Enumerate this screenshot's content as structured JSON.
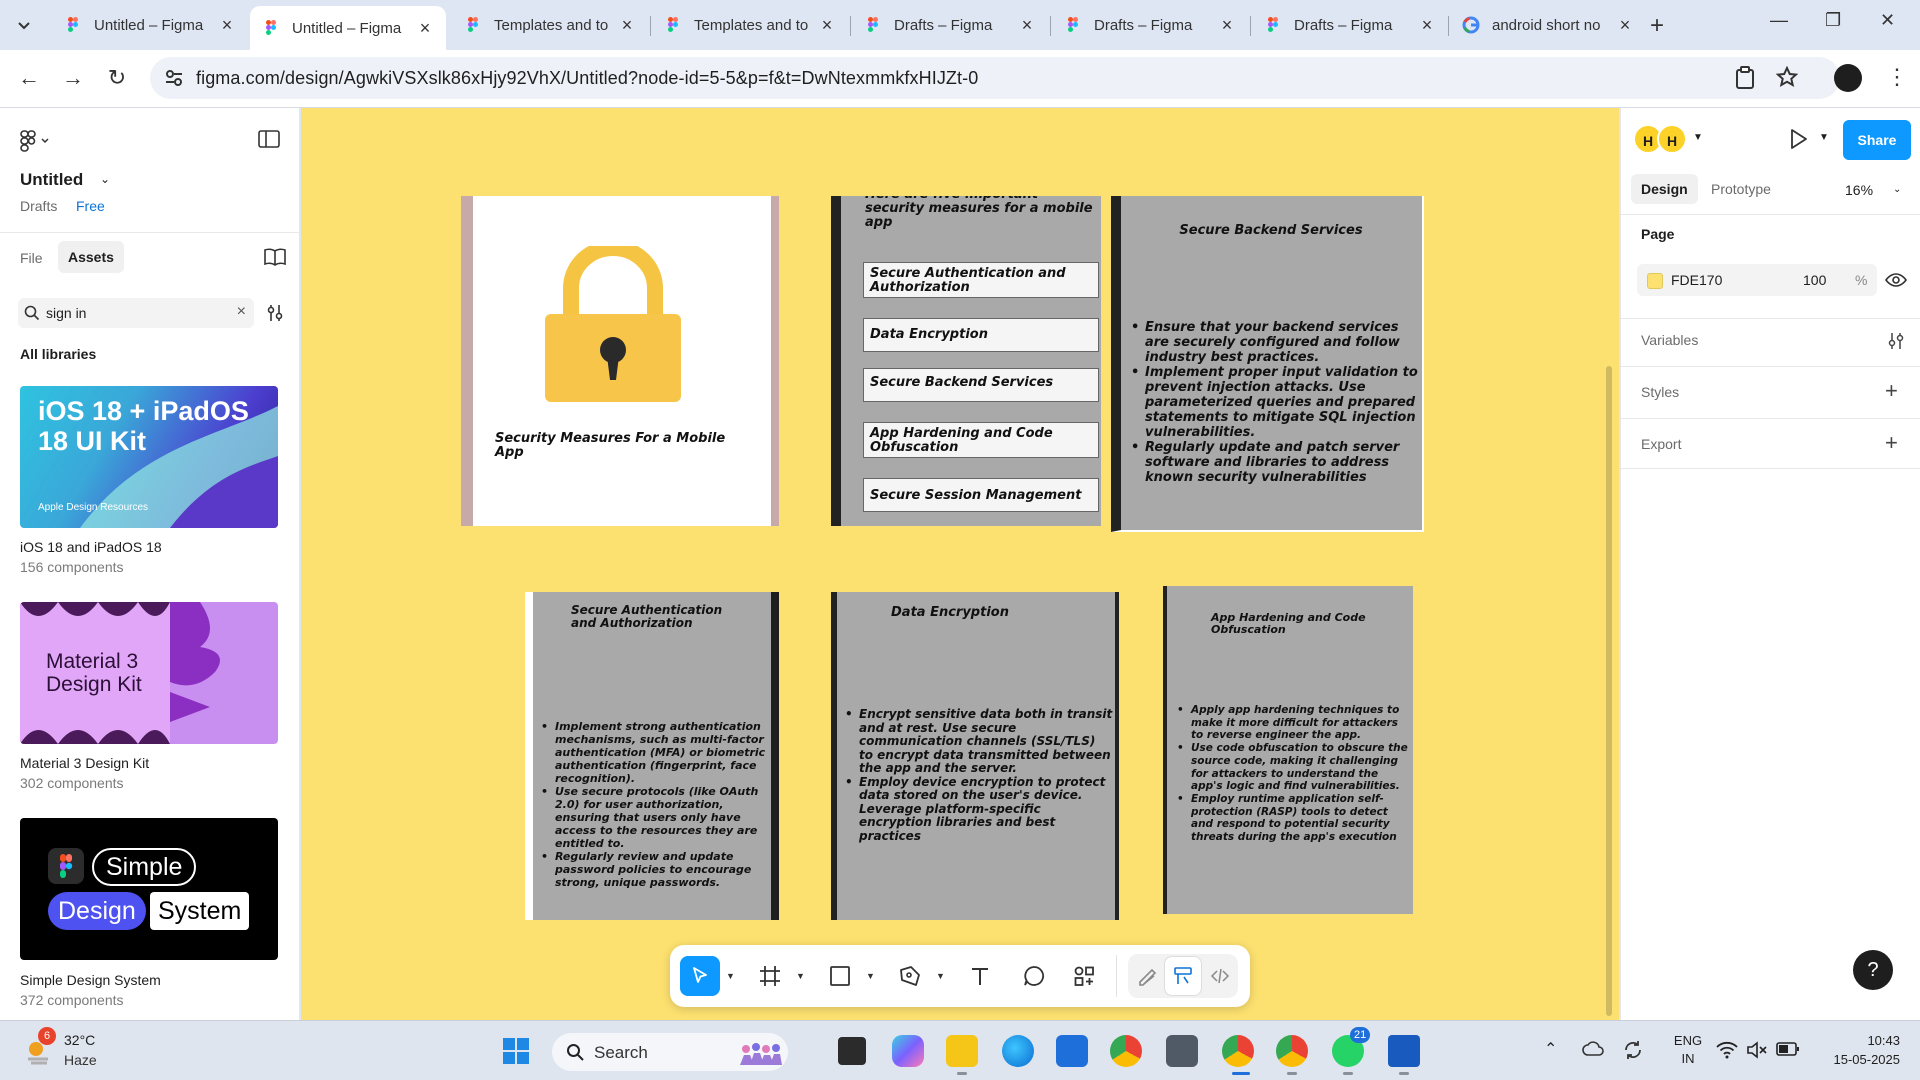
{
  "browser": {
    "tabs": [
      {
        "title": "Untitled – Figma",
        "icon": "figma"
      },
      {
        "title": "Untitled – Figma",
        "icon": "figma",
        "active": true
      },
      {
        "title": "Templates and to",
        "icon": "figma"
      },
      {
        "title": "Templates and to",
        "icon": "figma"
      },
      {
        "title": "Drafts – Figma",
        "icon": "figma"
      },
      {
        "title": "Drafts – Figma",
        "icon": "figma"
      },
      {
        "title": "Drafts – Figma",
        "icon": "figma"
      },
      {
        "title": "android short no",
        "icon": "google"
      }
    ],
    "url": "figma.com/design/AgwkiVSXslk86xHjy92VhX/Untitled?node-id=5-5&p=f&t=DwNtexmmkfxHIJZt-0"
  },
  "left_panel": {
    "file_title": "Untitled",
    "drafts": "Drafts",
    "plan": "Free",
    "tab_file": "File",
    "tab_assets": "Assets",
    "search_value": "sign in",
    "all_libraries": "All libraries",
    "libraries": [
      {
        "name": "iOS 18 and iPadOS 18",
        "count": "156 components",
        "thumb_title": "iOS 18 + iPadOS 18 UI Kit",
        "thumb_sub": "Apple Design Resources"
      },
      {
        "name": "Material 3 Design Kit",
        "count": "302 components",
        "thumb_title": "Material 3 Design Kit"
      },
      {
        "name": "Simple Design System",
        "count": "372 components",
        "thumb_words": [
          "Simple",
          "Design",
          "System"
        ]
      }
    ]
  },
  "canvas": {
    "background": "#FDE170",
    "cover": {
      "title": "Security Measures For a Mobile App"
    },
    "menu": {
      "intro": "Here are five important security measures for a mobile app",
      "items": [
        "Secure Authentication and Authorization",
        "Data Encryption",
        "Secure Backend Services",
        "App Hardening and Code Obfuscation",
        "Secure Session Management"
      ]
    },
    "backend": {
      "title": "Secure Backend Services",
      "bullets": [
        "Ensure that your backend services are securely configured and follow industry best practices.",
        "Implement proper input validation to prevent injection attacks. Use parameterized queries and prepared statements to mitigate SQL injection vulnerabilities.",
        "Regularly update and patch server software and libraries to address known security vulnerabilities"
      ]
    },
    "auth": {
      "title": "Secure Authentication and Authorization",
      "bullets": [
        "Implement strong authentication mechanisms, such as multi-factor authentication (MFA) or biometric authentication (fingerprint, face recognition).",
        "Use secure protocols (like OAuth 2.0) for user authorization, ensuring that users only have access to the resources they are entitled to.",
        "Regularly review and update password policies to encourage strong, unique passwords."
      ]
    },
    "encryption": {
      "title": "Data Encryption",
      "bullets": [
        "Encrypt sensitive data both in transit and at rest. Use secure communication channels (SSL/TLS) to encrypt data transmitted between the app and the server.",
        "Employ device encryption to protect data stored on the user's device. Leverage platform-specific encryption libraries and best practices"
      ]
    },
    "hardening": {
      "title": "App Hardening and Code Obfuscation",
      "bullets": [
        "Apply app hardening techniques to make it more difficult for attackers to reverse engineer the app.",
        "Use code obfuscation to obscure the source code, making it challenging for attackers to understand the app's logic and find vulnerabilities.",
        "Employ runtime application self-protection (RASP) tools to detect and respond to potential security threats during the app's execution"
      ]
    }
  },
  "right_panel": {
    "avatars": [
      "H",
      "H"
    ],
    "share": "Share",
    "tab_design": "Design",
    "tab_prototype": "Prototype",
    "zoom": "16%",
    "page_label": "Page",
    "page_color": "FDE170",
    "page_opacity": "100",
    "page_opacity_unit": "%",
    "variables": "Variables",
    "styles": "Styles",
    "export": "Export",
    "help": "?"
  },
  "taskbar": {
    "weather_badge": "6",
    "temperature": "32°C",
    "condition": "Haze",
    "search": "Search",
    "lang1": "ENG",
    "lang2": "IN",
    "time": "10:43",
    "date": "15-05-2025",
    "whatsapp_badge": "21"
  }
}
